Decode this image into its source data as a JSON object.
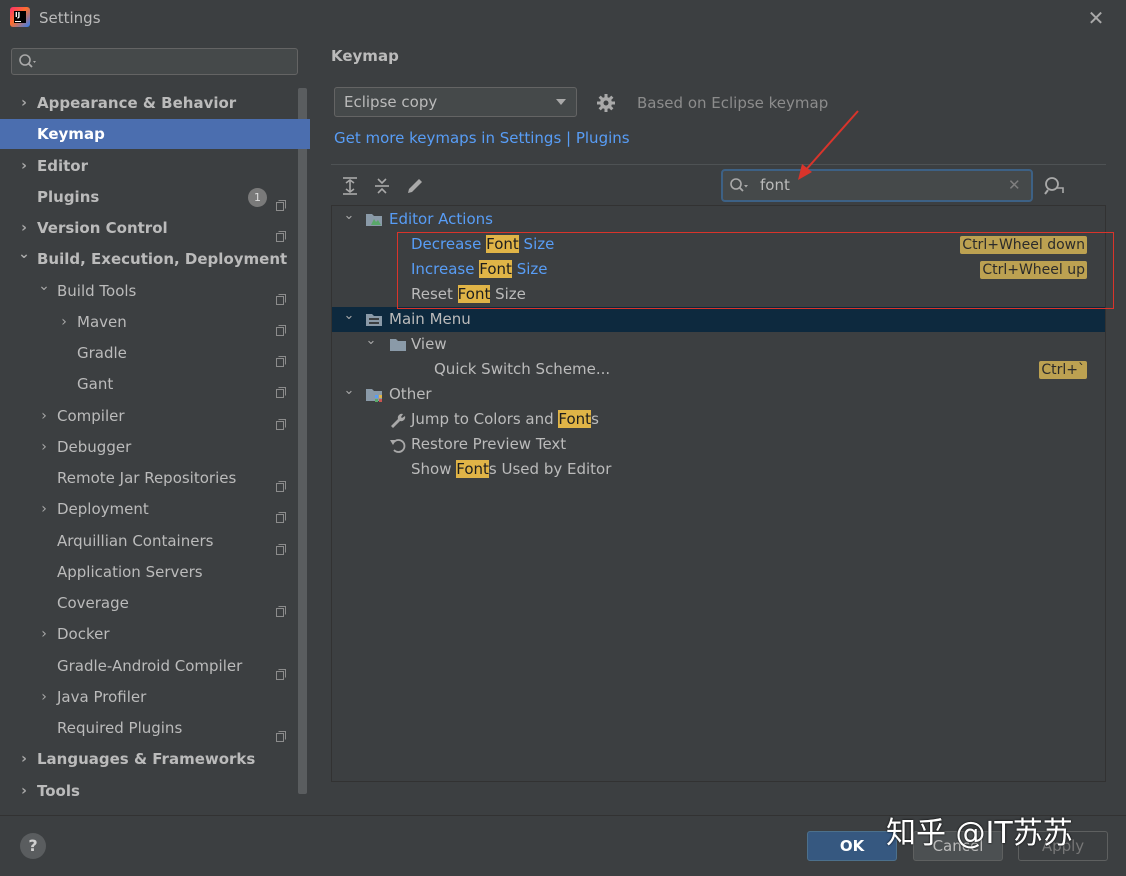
{
  "window": {
    "title": "Settings"
  },
  "sidebar": {
    "search_placeholder": "",
    "items": [
      {
        "label": "Appearance & Behavior",
        "bold": true,
        "expand": "collapsed",
        "level": 0
      },
      {
        "label": "Keymap",
        "bold": true,
        "expand": "none",
        "level": 0,
        "selected": true
      },
      {
        "label": "Editor",
        "bold": true,
        "expand": "collapsed",
        "level": 0
      },
      {
        "label": "Plugins",
        "bold": true,
        "expand": "none",
        "level": 0,
        "badge": "1",
        "page_icon": true
      },
      {
        "label": "Version Control",
        "bold": true,
        "expand": "collapsed",
        "level": 0,
        "page_icon": true
      },
      {
        "label": "Build, Execution, Deployment",
        "bold": true,
        "expand": "expanded",
        "level": 0
      },
      {
        "label": "Build Tools",
        "expand": "expanded",
        "level": 1,
        "page_icon": true
      },
      {
        "label": "Maven",
        "expand": "collapsed",
        "level": 2,
        "page_icon": true
      },
      {
        "label": "Gradle",
        "expand": "none",
        "level": 2,
        "page_icon": true
      },
      {
        "label": "Gant",
        "expand": "none",
        "level": 2,
        "page_icon": true
      },
      {
        "label": "Compiler",
        "expand": "collapsed",
        "level": 1,
        "page_icon": true
      },
      {
        "label": "Debugger",
        "expand": "collapsed",
        "level": 1
      },
      {
        "label": "Remote Jar Repositories",
        "expand": "none",
        "level": 1,
        "page_icon": true
      },
      {
        "label": "Deployment",
        "expand": "collapsed",
        "level": 1,
        "page_icon": true
      },
      {
        "label": "Arquillian Containers",
        "expand": "none",
        "level": 1,
        "page_icon": true
      },
      {
        "label": "Application Servers",
        "expand": "none",
        "level": 1
      },
      {
        "label": "Coverage",
        "expand": "none",
        "level": 1,
        "page_icon": true
      },
      {
        "label": "Docker",
        "expand": "collapsed",
        "level": 1
      },
      {
        "label": "Gradle-Android Compiler",
        "expand": "none",
        "level": 1,
        "page_icon": true
      },
      {
        "label": "Java Profiler",
        "expand": "collapsed",
        "level": 1
      },
      {
        "label": "Required Plugins",
        "expand": "none",
        "level": 1,
        "page_icon": true
      },
      {
        "label": "Languages & Frameworks",
        "bold": true,
        "expand": "collapsed",
        "level": 0
      },
      {
        "label": "Tools",
        "bold": true,
        "expand": "collapsed",
        "level": 0
      }
    ]
  },
  "main": {
    "heading": "Keymap",
    "keymap_combo_value": "Eclipse copy",
    "based_on": "Based on Eclipse keymap",
    "more_link": "Get more keymaps in Settings | Plugins",
    "filter_value": "font",
    "tree": [
      {
        "level": 0,
        "expand": "expanded",
        "icon": "editor-actions-folder-icon",
        "parts": [
          "Editor Actions"
        ],
        "blue": true
      },
      {
        "level": 1,
        "expand": "none",
        "icon": "",
        "parts": [
          "Decrease ",
          "Font",
          " Size"
        ],
        "blue": true,
        "shortcut": "Ctrl+Wheel down"
      },
      {
        "level": 1,
        "expand": "none",
        "icon": "",
        "parts": [
          "Increase ",
          "Font",
          " Size"
        ],
        "blue": true,
        "shortcut": "Ctrl+Wheel up"
      },
      {
        "level": 1,
        "expand": "none",
        "icon": "",
        "parts": [
          "Reset ",
          "Font",
          " Size"
        ]
      },
      {
        "level": 0,
        "expand": "expanded",
        "icon": "main-menu-folder-icon",
        "parts": [
          "Main Menu"
        ],
        "selected": true
      },
      {
        "level": 1,
        "expand": "expanded",
        "icon": "folder-icon",
        "parts": [
          "View"
        ]
      },
      {
        "level": 2,
        "expand": "none",
        "icon": "",
        "parts": [
          "Quick Switch Scheme..."
        ],
        "shortcut": "Ctrl+`"
      },
      {
        "level": 0,
        "expand": "expanded",
        "icon": "other-folder-icon",
        "parts": [
          "Other"
        ]
      },
      {
        "level": 1,
        "expand": "none",
        "icon": "wrench-icon",
        "parts": [
          "Jump to Colors and ",
          "Font",
          "s"
        ]
      },
      {
        "level": 1,
        "expand": "none",
        "icon": "restore-icon",
        "parts": [
          "Restore Preview Text"
        ]
      },
      {
        "level": 1,
        "expand": "none",
        "icon": "",
        "parts": [
          "Show ",
          "Font",
          "s Used by Editor"
        ]
      }
    ]
  },
  "footer": {
    "help": "?",
    "ok": "OK",
    "cancel": "Cancel",
    "apply": "Apply"
  },
  "watermark": "知乎 @IT苏苏",
  "colors": {
    "accent": "#4b6eaf",
    "link": "#589df6",
    "highlight": "#e0b447",
    "annotation": "#d9342b"
  }
}
